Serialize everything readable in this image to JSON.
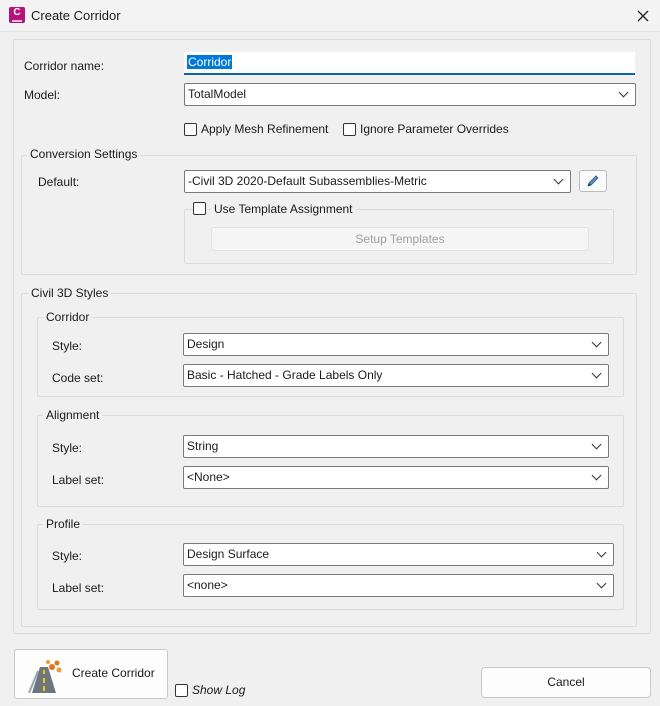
{
  "window": {
    "title": "Create Corridor",
    "icon_letter": "C"
  },
  "form": {
    "corridor_name_label": "Corridor name:",
    "corridor_name_value": "Corridor",
    "model_label": "Model:",
    "model_value": "TotalModel",
    "apply_mesh_refinement": "Apply Mesh Refinement",
    "ignore_parameter_overrides": "Ignore Parameter Overrides"
  },
  "conversion": {
    "title": "Conversion Settings",
    "default_label": "Default:",
    "default_value": "-Civil 3D 2020-Default Subassemblies-Metric",
    "use_template_assignment": "Use Template Assignment",
    "setup_templates": "Setup Templates"
  },
  "styles": {
    "title": "Civil 3D Styles",
    "corridor": {
      "title": "Corridor",
      "style_label": "Style:",
      "style_value": "Design",
      "codeset_label": "Code set:",
      "codeset_value": "Basic - Hatched - Grade Labels Only"
    },
    "alignment": {
      "title": "Alignment",
      "style_label": "Style:",
      "style_value": "String",
      "labelset_label": "Label set:",
      "labelset_value": "<None>"
    },
    "profile": {
      "title": "Profile",
      "style_label": "Style:",
      "style_value": "Design Surface",
      "labelset_label": "Label set:",
      "labelset_value": "<none>"
    }
  },
  "footer": {
    "create_corridor": "Create Corridor",
    "show_log": "Show Log",
    "cancel": "Cancel"
  },
  "colors": {
    "accent": "#0a64ad",
    "selection": "#0078d7",
    "app_icon": "#b5127a"
  }
}
